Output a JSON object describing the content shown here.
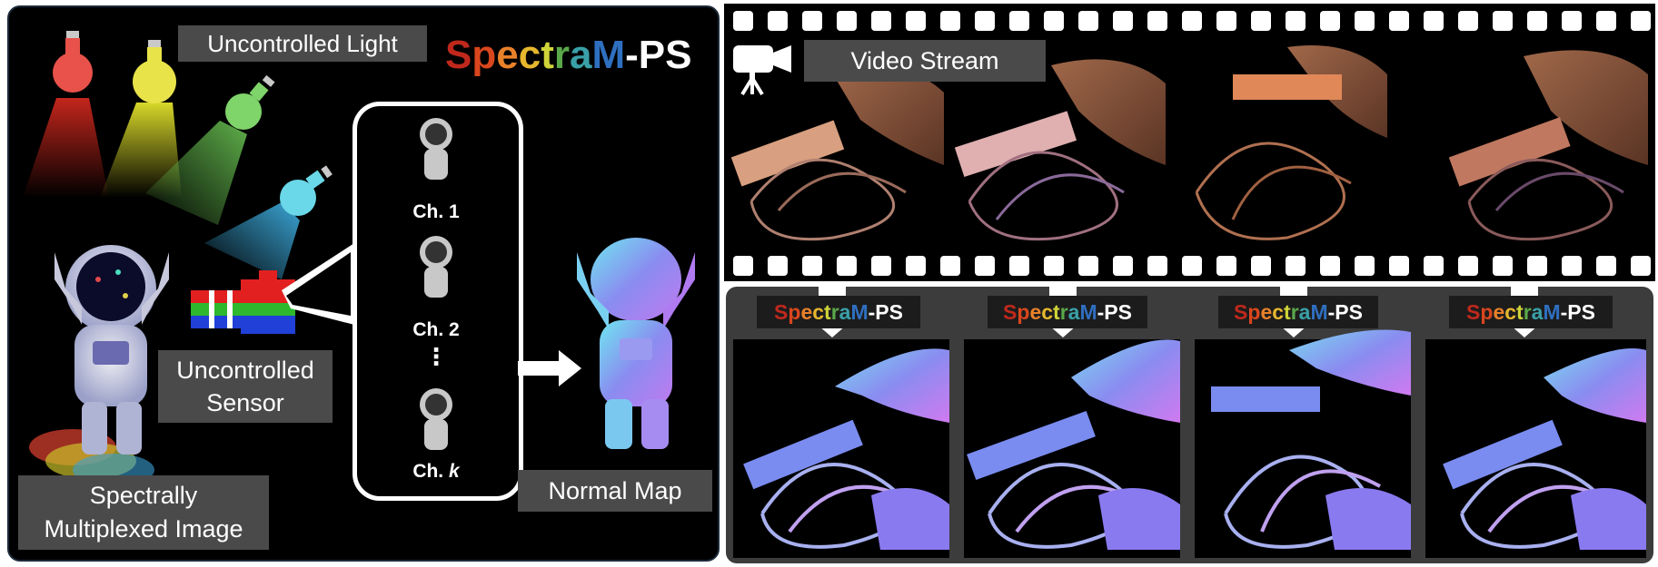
{
  "left": {
    "uncontrolled_light": "Uncontrolled Light",
    "brand": {
      "parts": [
        {
          "t": "S",
          "c": "#c0281c"
        },
        {
          "t": "p",
          "c": "#d9461e"
        },
        {
          "t": "e",
          "c": "#e9812a"
        },
        {
          "t": "c",
          "c": "#e6b72e"
        },
        {
          "t": "t",
          "c": "#cfd43a"
        },
        {
          "t": "r",
          "c": "#5aa84a"
        },
        {
          "t": "a",
          "c": "#3aa0a8"
        },
        {
          "t": "M",
          "c": "#2f6fc0"
        },
        {
          "t": "-PS",
          "c": "#ffffff"
        }
      ]
    },
    "sensor_line1": "Uncontrolled",
    "sensor_line2": "Sensor",
    "image_line1": "Spectrally",
    "image_line2": "Multiplexed Image",
    "normal_map": "Normal Map",
    "channels": {
      "ch1": "Ch. 1",
      "ch2": "Ch. 2",
      "dots": "⋮",
      "chk_prefix": "Ch. ",
      "chk_var": "k"
    },
    "bulb_colors": [
      "#e8524a",
      "#e9e34a",
      "#7fd46a",
      "#6ad8e8"
    ]
  },
  "film": {
    "video_stream": "Video Stream"
  },
  "bottom": {
    "brand_label": "SpectraM-PS"
  }
}
